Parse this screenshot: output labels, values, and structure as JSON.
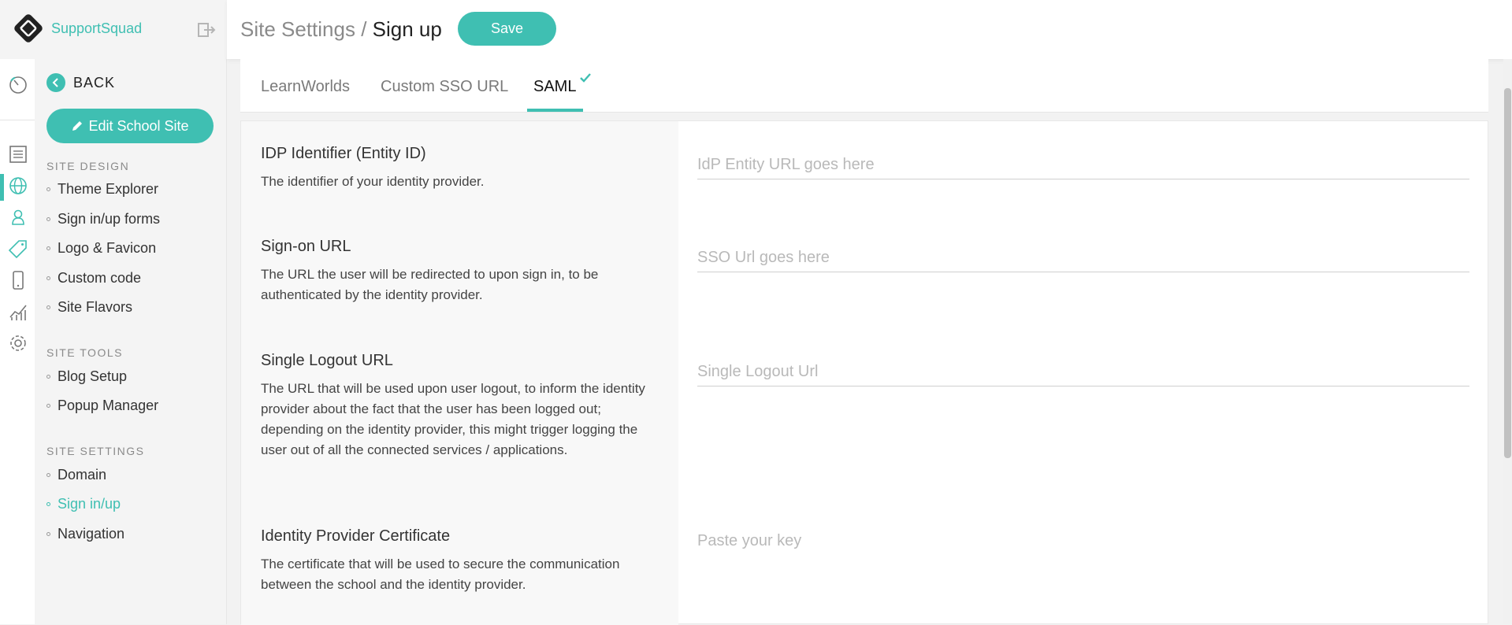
{
  "brand": {
    "name": "SupportSquad",
    "logo_icon": "supportsquad-logo-icon",
    "logout_icon": "logout-icon"
  },
  "header": {
    "crumb_parent": "Site Settings",
    "crumb_sep": " / ",
    "crumb_current": "Sign up",
    "save_label": "Save"
  },
  "rail": {
    "icons": [
      "dashboard-icon",
      "pages-icon",
      "globe-icon",
      "user-icon",
      "tag-icon",
      "mobile-icon",
      "analytics-icon",
      "settings-icon"
    ]
  },
  "sidebar": {
    "back_label": "BACK",
    "edit_label": "Edit School Site",
    "site_design_title": "SITE DESIGN",
    "site_design_items": [
      "Theme Explorer",
      "Sign in/up forms",
      "Logo & Favicon",
      "Custom code",
      "Site Flavors"
    ],
    "site_tools_title": "SITE TOOLS",
    "site_tools_items": [
      "Blog Setup",
      "Popup Manager"
    ],
    "site_settings_title": "SITE SETTINGS",
    "site_settings_items": [
      "Domain",
      "Sign in/up",
      "Navigation"
    ],
    "active_item": "Sign in/up"
  },
  "tabs": {
    "t1": "LearnWorlds",
    "t2": "Custom SSO URL",
    "t3": "SAML",
    "active": "SAML"
  },
  "fields": {
    "idp_title": "IDP Identifier (Entity ID)",
    "idp_desc": "The identifier of your identity provider.",
    "idp_placeholder": "IdP Entity URL goes here",
    "signon_title": "Sign-on URL",
    "signon_desc": "The URL the user will be redirected to upon sign in, to be authenticated by the identity provider.",
    "signon_placeholder": "SSO Url goes here",
    "logout_title": "Single Logout URL",
    "logout_desc": "The URL that will be used upon user logout, to inform the identity provider about the fact that the user has been logged out; depending on the identity provider, this might trigger logging the user out of all the connected services / applications.",
    "logout_placeholder": "Single Logout Url",
    "cert_title": "Identity Provider Certificate",
    "cert_desc": "The certificate that will be used to secure the communication between the school and the identity provider.",
    "cert_placeholder": "Paste your key"
  },
  "colors": {
    "accent": "#3fbfb2",
    "sidebar_bg": "#f4f4f4"
  }
}
